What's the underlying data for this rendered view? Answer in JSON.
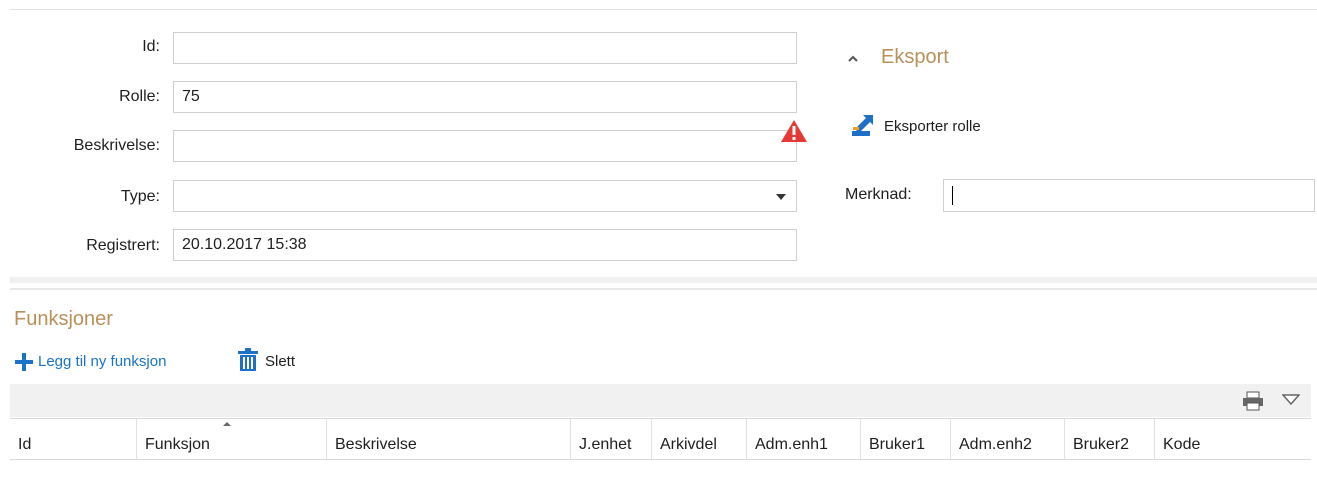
{
  "form": {
    "id": {
      "label": "Id:",
      "value": ""
    },
    "rolle": {
      "label": "Rolle:",
      "value": "75"
    },
    "beskrivelse": {
      "label": "Beskrivelse:",
      "value": ""
    },
    "type": {
      "label": "Type:",
      "value": ""
    },
    "registrert": {
      "label": "Registrert:",
      "value": "20.10.2017 15:38"
    }
  },
  "eksport": {
    "title": "Eksport",
    "button_label": "Eksporter rolle",
    "merknad_label": "Merknad:",
    "merknad_value": ""
  },
  "funksjoner": {
    "title": "Funksjoner",
    "add_label": "Legg til ny funksjon",
    "delete_label": "Slett",
    "columns": [
      "Id",
      "Funksjon",
      "Beskrivelse",
      "J.enhet",
      "Arkivdel",
      "Adm.enh1",
      "Bruker1",
      "Adm.enh2",
      "Bruker2",
      "Kode"
    ]
  },
  "colors": {
    "accent": "#b8915a",
    "link": "#1a73c8",
    "warning": "#e53935",
    "icon_blue": "#1e6fc8"
  }
}
